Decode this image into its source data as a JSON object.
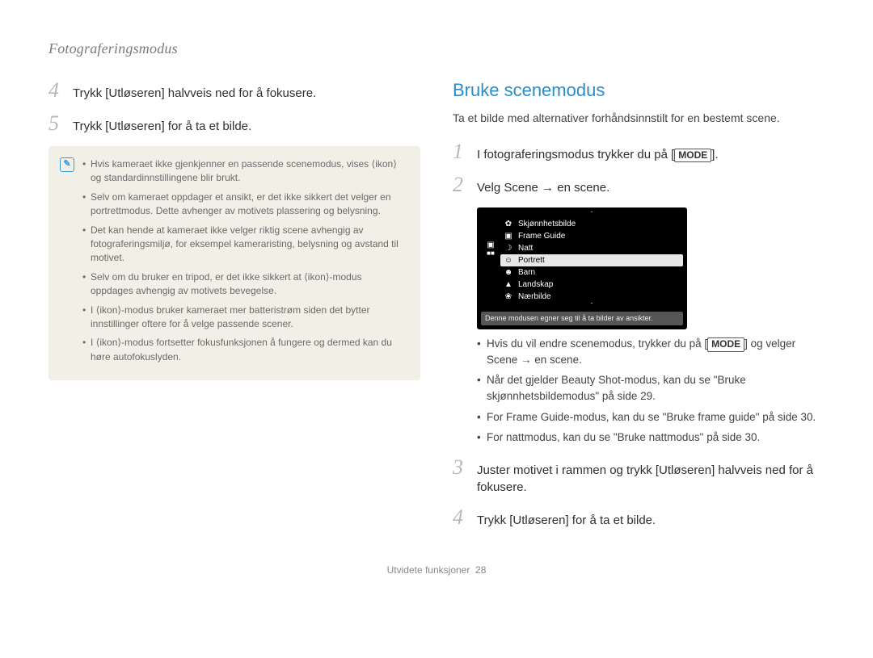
{
  "header": "Fotograferingsmodus",
  "left": {
    "steps": [
      {
        "num": "4",
        "text": "Trykk [Utløseren] halvveis ned for å fokusere."
      },
      {
        "num": "5",
        "text": "Trykk [Utløseren] for å ta et bilde."
      }
    ],
    "info": [
      "Hvis kameraet ikke gjenkjenner en passende scenemodus, vises ⟨ikon⟩ og standardinnstillingene blir brukt.",
      "Selv om kameraet oppdager et ansikt, er det ikke sikkert det velger en portrettmodus. Dette avhenger av motivets plassering og belysning.",
      "Det kan hende at kameraet ikke velger riktig scene avhengig av fotograferingsmiljø, for eksempel kameraristing, belysning og avstand til motivet.",
      "Selv om du bruker en tripod, er det ikke sikkert at ⟨ikon⟩-modus oppdages avhengig av motivets bevegelse.",
      "I ⟨ikon⟩-modus bruker kameraet mer batteristrøm siden det bytter innstillinger oftere for å velge passende scener.",
      "I ⟨ikon⟩-modus fortsetter fokusfunksjonen å fungere og dermed kan du høre autofokuslyden."
    ]
  },
  "right": {
    "title": "Bruke scenemodus",
    "intro": "Ta et bilde med alternativer forhåndsinnstilt for en bestemt scene.",
    "step1": {
      "num": "1",
      "pre": "I fotograferingsmodus trykker du på [",
      "btn": "MODE",
      "post": "]."
    },
    "step2": {
      "num": "2",
      "text": "Velg Scene → en scene."
    },
    "menu": {
      "items": [
        {
          "label": "Skjønnhetsbilde",
          "selected": false
        },
        {
          "label": "Frame Guide",
          "selected": false
        },
        {
          "label": "Natt",
          "selected": false
        },
        {
          "label": "Portrett",
          "selected": true
        },
        {
          "label": "Barn",
          "selected": false
        },
        {
          "label": "Landskap",
          "selected": false
        },
        {
          "label": "Nærbilde",
          "selected": false
        }
      ],
      "caption": "Denne modusen egner seg til å ta bilder av ansikter."
    },
    "midBullets": [
      {
        "pre": "Hvis du vil endre scenemodus, trykker du på [",
        "btn": "MODE",
        "post": "] og velger Scene → en scene."
      },
      {
        "text": "Når det gjelder Beauty Shot-modus, kan du se \"Bruke skjønnhetsbildemodus\" på side 29."
      },
      {
        "text": "For Frame Guide-modus, kan du se \"Bruke frame guide\" på side 30."
      },
      {
        "text": "For nattmodus, kan du se \"Bruke nattmodus\" på side 30."
      }
    ],
    "step3": {
      "num": "3",
      "text": "Juster motivet i rammen og trykk [Utløseren] halvveis ned for å fokusere."
    },
    "step4": {
      "num": "4",
      "text": "Trykk [Utløseren] for å ta et bilde."
    }
  },
  "footer": {
    "label": "Utvidete funksjoner",
    "page": "28"
  }
}
